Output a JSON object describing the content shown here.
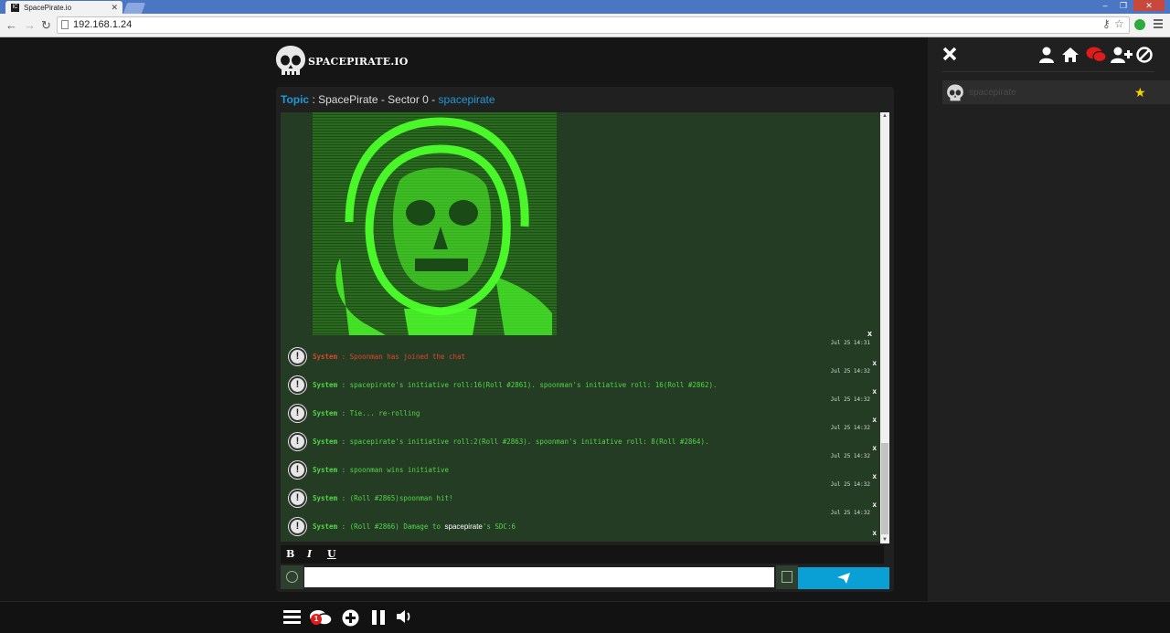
{
  "browser": {
    "tab_title": "SpacePirate.io",
    "tab_favicon": "IC",
    "url": "192.168.1.24"
  },
  "app": {
    "brand": "SPACEPIRATE.IO"
  },
  "topic": {
    "label": "Topic",
    "separator": " : ",
    "name": "SpacePirate - Sector 0 - ",
    "owner": "spacepirate"
  },
  "messages": [
    {
      "time": "Jul 25 14:31",
      "sender": "System",
      "text": " : Spoonman has joined the chat",
      "type": "join"
    },
    {
      "time": "Jul 25 14:32",
      "sender": "System",
      "text": " : spacepirate's initiative roll:16(Roll #2861). spoonman's initiative roll: 16(Roll #2862).",
      "type": "normal"
    },
    {
      "time": "Jul 25 14:32",
      "sender": "System",
      "text": " : Tie... re-rolling",
      "type": "normal"
    },
    {
      "time": "Jul 25 14:32",
      "sender": "System",
      "text": " : spacepirate's initiative roll:2(Roll #2863). spoonman's initiative roll: 8(Roll #2864).",
      "type": "normal"
    },
    {
      "time": "Jul 25 14:32",
      "sender": "System",
      "text": " : spoonman wins initiative",
      "type": "normal"
    },
    {
      "time": "Jul 25 14:32",
      "sender": "System",
      "text": " : (Roll #2865)spoonman hit!",
      "type": "normal"
    },
    {
      "time": "Jul 25 14:32",
      "sender": "System",
      "text_before": " : (Roll #2866) Damage to ",
      "highlight": "spacepirate",
      "text_after": "'s SDC:6",
      "type": "damage"
    }
  ],
  "formatting": {
    "bold": "B",
    "italic": "I",
    "underline": "U"
  },
  "input": {
    "value": "",
    "placeholder": ""
  },
  "bottom_bar": {
    "notification_count": "1"
  },
  "sidebar": {
    "users": [
      {
        "name": "spacepirate",
        "favorite": true
      }
    ]
  },
  "colors": {
    "accent": "#0aa0d6",
    "chat_bg": "#233c23",
    "system_text": "#54d64a",
    "join_text": "#e0452f",
    "star": "#f5d400",
    "chat_icon_active": "#e01b1b"
  }
}
